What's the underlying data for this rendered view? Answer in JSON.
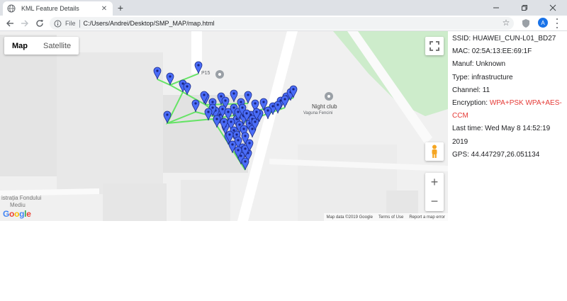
{
  "browser": {
    "tab_title": "KML Feature Details",
    "scheme_label": "File",
    "url": "C:/Users/Andrei/Desktop/SMP_MAP/map.html",
    "profile_initial": "A"
  },
  "map": {
    "map_button": "Map",
    "satellite_button": "Satellite",
    "labels": {
      "p15": "P15",
      "night_club": "Night club",
      "vaguna": "Vaguna Fencini",
      "administratia_1": "istrația Fondului",
      "administratia_2": "Mediu"
    },
    "attribution": {
      "data": "Map data ©2019 Google",
      "terms": "Terms of Use",
      "report": "Report a map error"
    },
    "colors": {
      "marker": "#4a6cf7",
      "path": "#66e366",
      "background": "#f0f0f0"
    }
  },
  "details": {
    "ssid": "SSID: HUAWEI_CUN-L01_BD27",
    "mac": "MAC: 02:5A:13:EE:69:1F",
    "manuf": "Manuf: Unknown",
    "type": "Type: infrastructure",
    "channel": "Channel: 11",
    "encryption_label": "Encryption: ",
    "encryption_value_1": "WPA+PSK WPA+AES-",
    "encryption_value_2": "CCM",
    "last_time_1": "Last time: Wed May 8 14:52:19",
    "last_time_2": "2019",
    "gps": "GPS: 44.447297,26.051134"
  }
}
